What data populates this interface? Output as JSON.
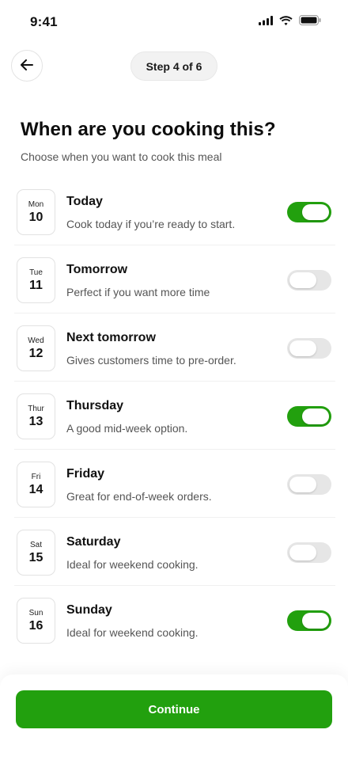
{
  "status_bar": {
    "time": "9:41",
    "icons": [
      "signal-icon",
      "wifi-icon",
      "battery-icon"
    ]
  },
  "header": {
    "back_icon": "arrow-left-icon",
    "step_label": "Step 4 of 6"
  },
  "main": {
    "title": "When are you cooking this?",
    "subtitle": "Choose when you want to cook this meal"
  },
  "days": [
    {
      "dow": "Mon",
      "date": "10",
      "title": "Today",
      "desc": "Cook today if you’re ready to start.",
      "enabled": true
    },
    {
      "dow": "Tue",
      "date": "11",
      "title": "Tomorrow",
      "desc": "Perfect if you want more time",
      "enabled": false
    },
    {
      "dow": "Wed",
      "date": "12",
      "title": "Next tomorrow",
      "desc": "Gives customers time to pre-order.",
      "enabled": false
    },
    {
      "dow": "Thur",
      "date": "13",
      "title": "Thursday",
      "desc": "A good mid-week option.",
      "enabled": true
    },
    {
      "dow": "Fri",
      "date": "14",
      "title": "Friday",
      "desc": "Great for end-of-week orders.",
      "enabled": false
    },
    {
      "dow": "Sat",
      "date": "15",
      "title": "Saturday",
      "desc": "Ideal for weekend cooking.",
      "enabled": false
    },
    {
      "dow": "Sun",
      "date": "16",
      "title": "Sunday",
      "desc": "Ideal for weekend cooking.",
      "enabled": true
    }
  ],
  "footer": {
    "continue_label": "Continue"
  },
  "colors": {
    "accent": "#22a00e",
    "toggle_off": "#e6e6e6",
    "text_primary": "#111111",
    "text_secondary": "#555555"
  }
}
